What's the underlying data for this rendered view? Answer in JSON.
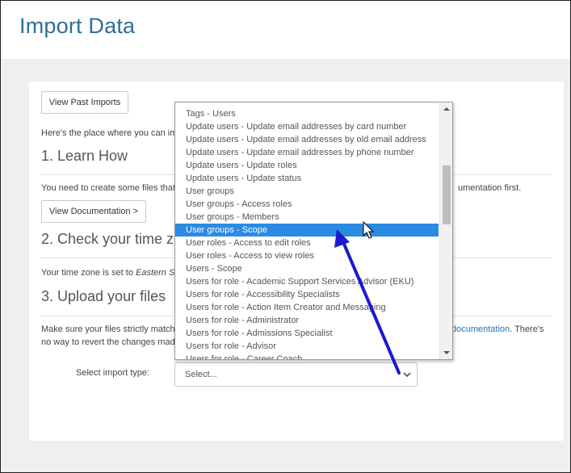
{
  "page": {
    "title": "Import Data"
  },
  "toolbar": {
    "view_past_imports": "View Past Imports"
  },
  "intro": {
    "text": "Here's the place where you can im"
  },
  "learn": {
    "heading": "1. Learn How",
    "text_left": "You need to create some files that",
    "text_right": "umentation first.",
    "button": "View Documentation >"
  },
  "timezone": {
    "heading": "2. Check your time z",
    "text_prefix": "Your time zone is set to ",
    "text_zone": "Eastern Sta"
  },
  "upload": {
    "heading": "3. Upload your files",
    "line1_left": "Make sure your files strictly match",
    "line1_link": "documentation",
    "line1_right": ". There's",
    "line2_left": "no way to revert the changes mad",
    "select_label": "Select import type:",
    "select_value": "Select..."
  },
  "dropdown": {
    "partial_item": "Tags - Users (top cut)",
    "items": [
      "Tags - Users",
      "Update users - Update email addresses by card number",
      "Update users - Update email addresses by old email address",
      "Update users - Update email addresses by phone number",
      "Update users - Update roles",
      "Update users - Update status",
      "User groups",
      "User groups - Access roles",
      "User groups - Members",
      "User groups - Scope",
      "User roles - Access to edit roles",
      "User roles - Access to view roles",
      "Users - Scope",
      "Users for role - Academic Support Services Advisor (EKU)",
      "Users for role - Accessibility Specialists",
      "Users for role - Action Item Creator and Messaging",
      "Users for role - Administrator",
      "Users for role - Admissions Specialist",
      "Users for role - Advisor",
      "Users for role - Career Coach"
    ],
    "selected_index": 9
  },
  "colors": {
    "title": "#2f6f95",
    "selected": "#2b8ae2",
    "arrow": "#1a1ad0",
    "link": "#2a73b3"
  },
  "icons": [
    "chevron-down-icon",
    "scroll-up-icon",
    "scroll-down-icon",
    "mouse-cursor-icon",
    "annotation-arrow"
  ]
}
